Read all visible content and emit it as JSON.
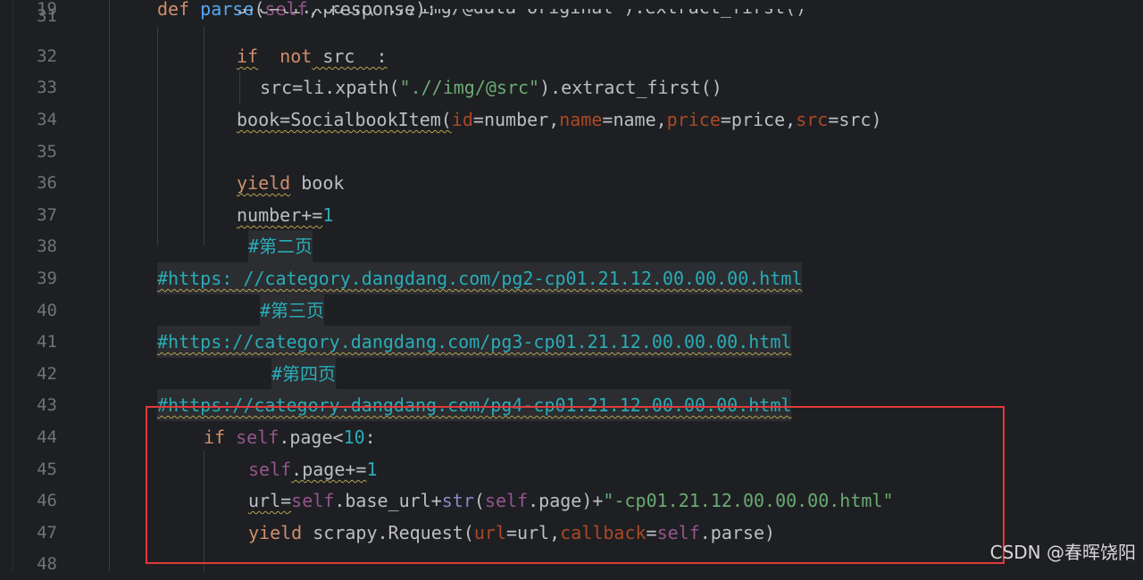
{
  "gutter": {
    "line_numbers": [
      "19",
      "31",
      "32",
      "33",
      "34",
      "35",
      "36",
      "37",
      "38",
      "39",
      "40",
      "41",
      "42",
      "43",
      "44",
      "45",
      "46",
      "47",
      "48"
    ]
  },
  "code": {
    "l19": {
      "kw": "def",
      "fn": "parse",
      "p1": "(",
      "self": "self",
      ", ": ", ",
      "arg": "response",
      "end": "):"
    },
    "l31": "src=li.xpath(\".//img/@data-original\").extract_first()",
    "l32": {
      "kw1": "if",
      "kw2": "not",
      "rest": " src  :"
    },
    "l33": {
      "a": "src=li.xpath(",
      "s": "\".//img/@src\"",
      "b": ").extract_first()"
    },
    "l34": {
      "a": "book=SocialbookItem(",
      "k1": "id",
      "b": "=number,",
      "k2": "name",
      "c": "=name,",
      "k3": "price",
      "d": "=price,",
      "k4": "src",
      "e": "=src)"
    },
    "l36": {
      "kw": "yield",
      "rest": " book"
    },
    "l37": {
      "a": "number+=",
      "n": "1"
    },
    "l38": "#第二页",
    "l39": "#https: //category.dangdang.com/pg2-cp01.21.12.00.00.00.html",
    "l40": "#第三页",
    "l41": "#https://category.dangdang.com/pg3-cp01.21.12.00.00.00.html",
    "l42": "#第四页",
    "l43": "#https://category.dangdang.com/pg4-cp01.21.12.00.00.00.html",
    "l44": {
      "kw": "if",
      "self": "self",
      "a": ".page<",
      "n": "10",
      "b": ":"
    },
    "l45": {
      "self": "self",
      "a": ".page+=",
      "n": "1"
    },
    "l46": {
      "a": "url=",
      "self1": "self",
      "b": ".base_url+",
      "bi": "str",
      "c": "(",
      "self2": "self",
      "d": ".page)+",
      "s": "\"-cp01.21.12.00.00.00.html\""
    },
    "l47": {
      "kw": "yield",
      "a": " scrapy.Request(",
      "k1": "url",
      "b": "=url,",
      "k2": "callback",
      "c": "=",
      "self": "self",
      "d": ".parse)"
    }
  },
  "watermark": "CSDN @春晖饶阳",
  "colors": {
    "background": "#1e1f22",
    "keyword": "#cf8e6d",
    "function": "#56a8f5",
    "self": "#94558d",
    "string": "#6aab73",
    "number": "#2aacb8",
    "highlight_border": "#e03a3a"
  }
}
